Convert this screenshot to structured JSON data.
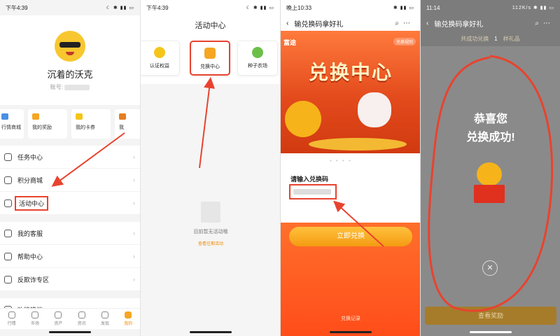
{
  "panel1": {
    "status": {
      "time": "下午4:39"
    },
    "profile": {
      "name": "沉着的沃克",
      "account_label": "账号:"
    },
    "quick_cards": [
      "行情商城",
      "我的奖励",
      "我的卡券",
      "我"
    ],
    "menu": {
      "task_center": "任务中心",
      "points_mall": "积分商城",
      "activity_center": "活动中心",
      "my_service": "我的客服",
      "help_center": "帮助中心",
      "anti_fraud": "反欺诈专区",
      "feedback": "功能建议"
    },
    "tabs": [
      "行情",
      "市场",
      "资产",
      "资讯",
      "发现",
      "我的"
    ]
  },
  "panel2": {
    "status": {
      "time": "下午4:39"
    },
    "title": "活动中心",
    "cards": [
      "认证权益",
      "兑换中心",
      "种子农场"
    ],
    "empty_text": "目前暂无活动哦",
    "empty_link": "查看往期活动"
  },
  "panel3": {
    "status": {
      "time": "晚上10:33"
    },
    "title": "输兑换码拿好礼",
    "brand": "富途",
    "banner_hint": "兑换规则",
    "banner_title": "兑换中心",
    "input_label": "请输入兑换码",
    "button": "立即兑换",
    "records_link": "兑换记录"
  },
  "panel4": {
    "status": {
      "time": "11:14",
      "speed": "112K/s"
    },
    "title": "输兑换码拿好礼",
    "count_prefix": "共成功兑换",
    "count_value": "1",
    "count_suffix": "样礼品",
    "congrats_line1": "恭喜您",
    "congrats_line2": "兑换成功!",
    "close_symbol": "✕",
    "view_button": "查看奖励"
  },
  "colors": {
    "accent": "#f5a623",
    "highlight_red": "#e8432f",
    "banner_orange": "#ff6f2b"
  }
}
